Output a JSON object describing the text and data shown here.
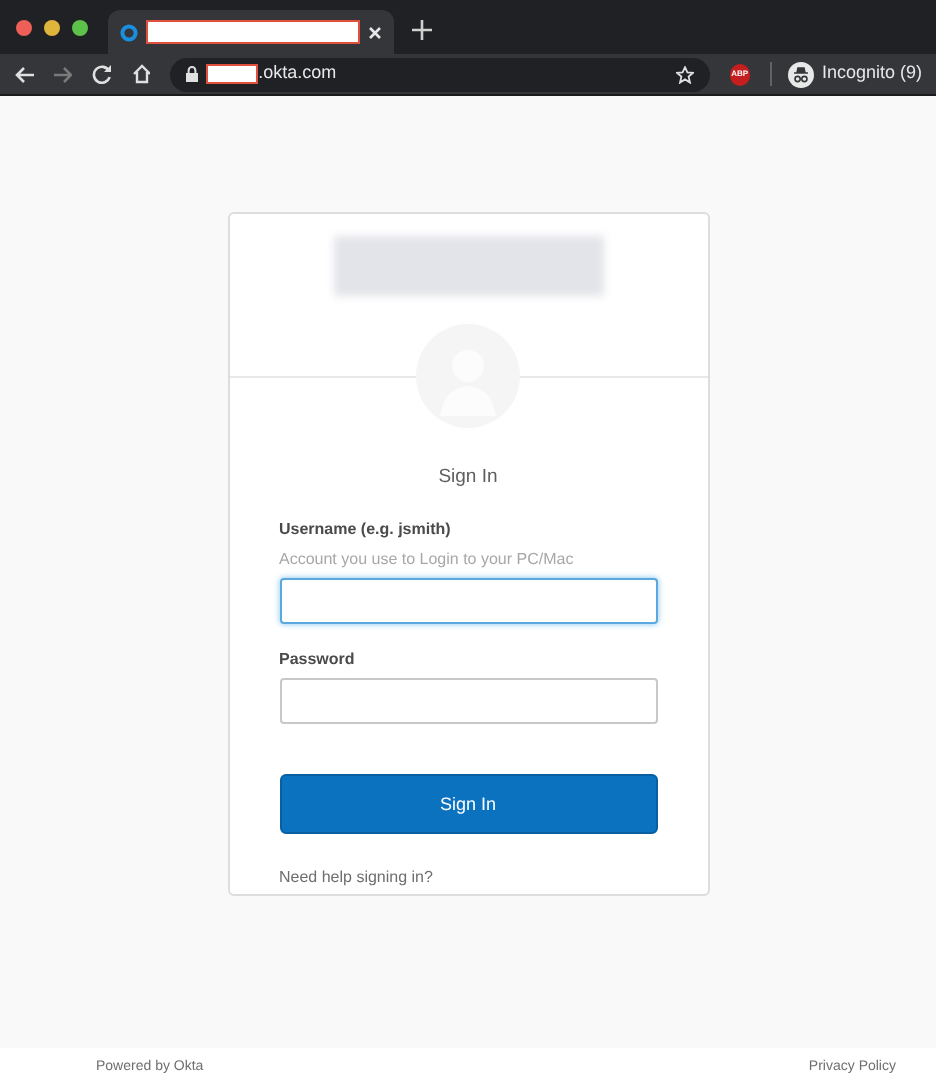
{
  "browser": {
    "url": ".okta.com",
    "extension_badge": "ABP",
    "profile": "Incognito (9)"
  },
  "sign_in": {
    "title": "Sign In",
    "fields": [
      {
        "label": "Username (e.g. jsmith)",
        "hint": "Account you use to Login to your PC/Mac",
        "focused": true
      },
      {
        "label": "Password",
        "focused": false
      }
    ],
    "button": "Sign In",
    "help_link": "Need help signing in?"
  },
  "footer": {
    "powered_by": "Powered by Okta",
    "privacy": "Privacy Policy"
  }
}
